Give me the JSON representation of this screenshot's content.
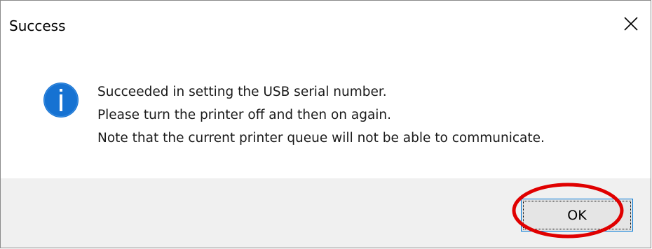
{
  "dialog": {
    "title": "Success",
    "close_icon": "close-icon",
    "info_icon": "info-icon",
    "messages": [
      "Succeeded in setting the USB serial number.",
      "Please turn the printer off and then on again.",
      "Note that the current printer queue will not be able to communicate."
    ],
    "ok_label": "OK"
  },
  "colors": {
    "info_blue": "#1672d2",
    "highlight_red": "#e00000",
    "focus_border": "#0078d7",
    "footer_bg": "#f0f0f0"
  }
}
